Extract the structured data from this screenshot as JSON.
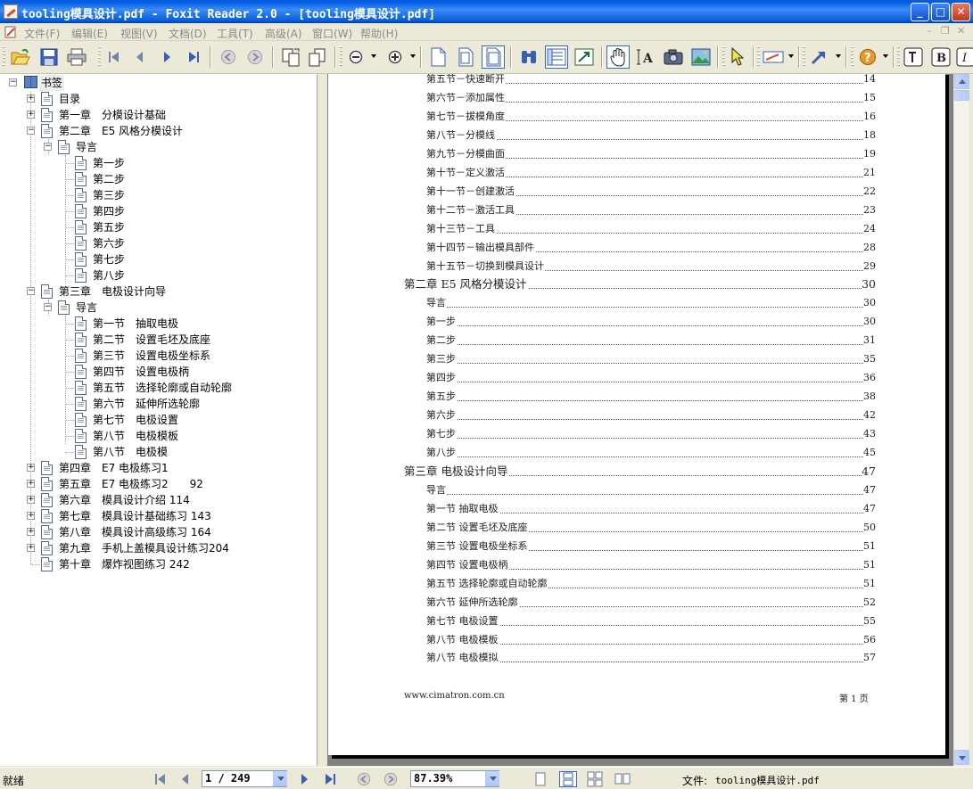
{
  "window": {
    "title": "tooling模具设计.pdf - Foxit Reader 2.0 - [tooling模具设计.pdf]",
    "minimize": "_",
    "maximize": "□",
    "close": "✕"
  },
  "menu": {
    "items": [
      "文件(F)",
      "编辑(E)",
      "视图(V)",
      "文档(D)",
      "工具(T)",
      "高级(A)",
      "窗口(W)",
      "帮助(H)"
    ],
    "mdi_controls": [
      "–",
      "❐",
      "✕"
    ]
  },
  "toolbar": {
    "buttons": [
      "open-icon",
      "save-icon",
      "print-icon",
      "first-page-icon",
      "previous-page-icon",
      "next-page-icon",
      "last-page-icon",
      "go-back-icon",
      "go-forward-icon",
      "rotate-icon",
      "copy-icon",
      "single-page-icon",
      "zoom-out-icon",
      "zoom-in-icon",
      "actual-size-icon",
      "fit-page-icon",
      "fit-width-icon",
      "find-icon",
      "bookmarks-icon",
      "thumbnails-icon",
      "hand-tool-icon",
      "text-select-icon",
      "snapshot-icon",
      "image-icon",
      "select-tool-icon",
      "annotation-icon",
      "arrow-tool-icon",
      "help-icon",
      "typewriter-icon",
      "bold-icon",
      "italic-icon"
    ]
  },
  "bookmarks": {
    "root": "书签",
    "items": [
      {
        "label": "目录",
        "level": 1,
        "expander": "+"
      },
      {
        "label": "第一章　分模设计基础",
        "level": 1,
        "expander": "+"
      },
      {
        "label": "第二章　E5 风格分模设计",
        "level": 1,
        "expander": "−"
      },
      {
        "label": "导言",
        "level": 2,
        "expander": "−"
      },
      {
        "label": "第一步",
        "level": 3,
        "expander": ""
      },
      {
        "label": "第二步",
        "level": 3,
        "expander": ""
      },
      {
        "label": "第三步",
        "level": 3,
        "expander": ""
      },
      {
        "label": "第四步",
        "level": 3,
        "expander": ""
      },
      {
        "label": "第五步",
        "level": 3,
        "expander": ""
      },
      {
        "label": "第六步",
        "level": 3,
        "expander": ""
      },
      {
        "label": "第七步",
        "level": 3,
        "expander": ""
      },
      {
        "label": "第八步",
        "level": 3,
        "expander": ""
      },
      {
        "label": "第三章　电极设计向导",
        "level": 1,
        "expander": "−"
      },
      {
        "label": "导言",
        "level": 2,
        "expander": "−"
      },
      {
        "label": "第一节　抽取电极",
        "level": 3,
        "expander": ""
      },
      {
        "label": "第二节　设置毛坯及底座",
        "level": 3,
        "expander": ""
      },
      {
        "label": "第三节　设置电极坐标系",
        "level": 3,
        "expander": ""
      },
      {
        "label": "第四节　设置电极柄",
        "level": 3,
        "expander": ""
      },
      {
        "label": "第五节　选择轮廓或自动轮廓",
        "level": 3,
        "expander": ""
      },
      {
        "label": "第六节　延伸所选轮廓",
        "level": 3,
        "expander": ""
      },
      {
        "label": "第七节　电极设置",
        "level": 3,
        "expander": ""
      },
      {
        "label": "第八节　电极模板",
        "level": 3,
        "expander": ""
      },
      {
        "label": "第八节　电极模",
        "level": 3,
        "expander": ""
      },
      {
        "label": "第四章　E7 电极练习1",
        "level": 1,
        "expander": "+"
      },
      {
        "label": "第五章　E7 电极练习2　　92",
        "level": 1,
        "expander": "+"
      },
      {
        "label": "第六章　模具设计介绍 114",
        "level": 1,
        "expander": "+"
      },
      {
        "label": "第七章　模具设计基础练习 143",
        "level": 1,
        "expander": "+"
      },
      {
        "label": "第八章　模具设计高级练习 164",
        "level": 1,
        "expander": "+"
      },
      {
        "label": "第九章　手机上盖模具设计练习204",
        "level": 1,
        "expander": "+"
      },
      {
        "label": "第十章　爆炸视图练习 242",
        "level": 1,
        "expander": ""
      }
    ]
  },
  "document": {
    "toc": [
      {
        "title": "第五节－快速断开",
        "page": "14",
        "chapter": false
      },
      {
        "title": "第六节－添加属性",
        "page": "15",
        "chapter": false
      },
      {
        "title": "第七节－拔模角度",
        "page": "16",
        "chapter": false
      },
      {
        "title": "第八节－分模线",
        "page": "18",
        "chapter": false
      },
      {
        "title": "第九节－分模曲面",
        "page": "19",
        "chapter": false
      },
      {
        "title": "第十节－定义激活",
        "page": "21",
        "chapter": false
      },
      {
        "title": "第十一节－创建激活",
        "page": "22",
        "chapter": false
      },
      {
        "title": "第十二节－激活工具",
        "page": "23",
        "chapter": false
      },
      {
        "title": "第十三节－工具",
        "page": "24",
        "chapter": false
      },
      {
        "title": "第十四节－输出模具部件",
        "page": "28",
        "chapter": false
      },
      {
        "title": "第十五节－切换到模具设计",
        "page": "29",
        "chapter": false
      },
      {
        "title": "第二章  E5 风格分模设计",
        "page": "30",
        "chapter": true
      },
      {
        "title": "导言",
        "page": "30",
        "chapter": false
      },
      {
        "title": "第一步",
        "page": "30",
        "chapter": false
      },
      {
        "title": "第二步",
        "page": "31",
        "chapter": false
      },
      {
        "title": "第三步",
        "page": "35",
        "chapter": false
      },
      {
        "title": "第四步",
        "page": "36",
        "chapter": false
      },
      {
        "title": "第五步",
        "page": "38",
        "chapter": false
      },
      {
        "title": "第六步",
        "page": "42",
        "chapter": false
      },
      {
        "title": "第七步",
        "page": "43",
        "chapter": false
      },
      {
        "title": "第八步",
        "page": "45",
        "chapter": false
      },
      {
        "title": "第三章  电极设计向导",
        "page": "47",
        "chapter": true
      },
      {
        "title": "导言",
        "page": "47",
        "chapter": false
      },
      {
        "title": "第一节  抽取电极",
        "page": "47",
        "chapter": false
      },
      {
        "title": "第二节  设置毛坯及底座",
        "page": "50",
        "chapter": false
      },
      {
        "title": "第三节  设置电极坐标系",
        "page": "51",
        "chapter": false
      },
      {
        "title": "第四节  设置电极柄",
        "page": "51",
        "chapter": false
      },
      {
        "title": "第五节  选择轮廓或自动轮廓",
        "page": "51",
        "chapter": false
      },
      {
        "title": "第六节  延伸所选轮廓",
        "page": "52",
        "chapter": false
      },
      {
        "title": "第七节  电极设置",
        "page": "55",
        "chapter": false
      },
      {
        "title": "第八节  电极模板",
        "page": "56",
        "chapter": false
      },
      {
        "title": "第八节  电极模拟",
        "page": "57",
        "chapter": false
      }
    ],
    "footer_url": "www.cimatron.com.cn",
    "footer_page": "第 1 页"
  },
  "status": {
    "text": "就绪",
    "page_value": "1 / 249",
    "zoom_value": "87.39%",
    "file_label": "文件:",
    "file_name": "tooling模具设计.pdf"
  },
  "colors": {
    "titlebar": "#0a5fd8",
    "chrome": "#ece9d8",
    "document_bg": "#808080"
  }
}
